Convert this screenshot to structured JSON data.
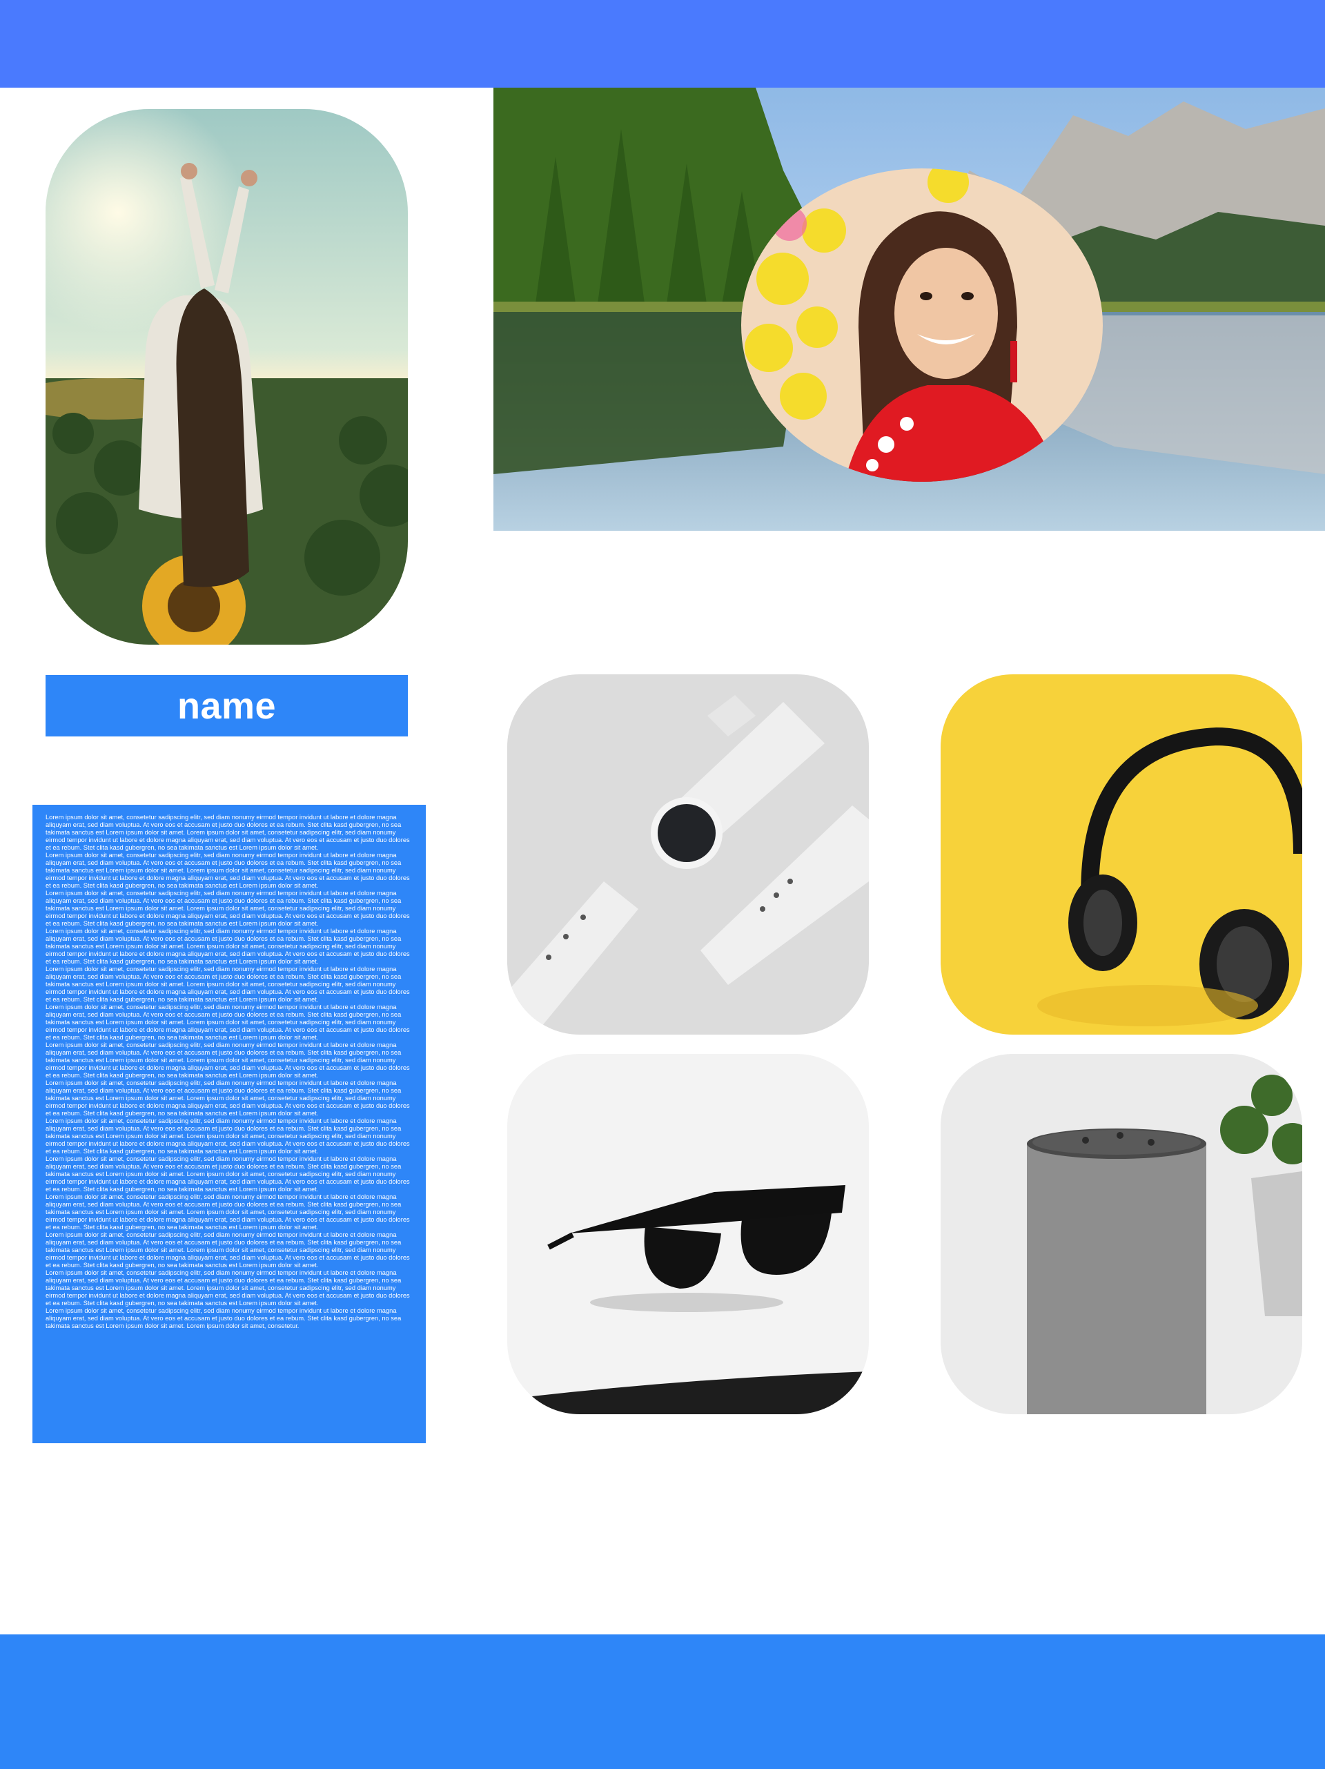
{
  "colors": {
    "header": "#4a7afe",
    "footer": "#2e86f8",
    "accent": "#2e86f8",
    "text_on_accent": "#ffffff"
  },
  "profile": {
    "photo_icon": "woman-in-sunflower-field-image",
    "cover_icon": "mountain-lake-landscape-image",
    "avatar_icon": "smiling-woman-portrait-image",
    "name": "name",
    "bio_paragraph": "Lorem ipsum dolor sit amet, consetetur sadipscing elitr, sed diam nonumy eirmod tempor invidunt ut labore et dolore magna aliquyam erat, sed diam voluptua. At vero eos et accusam et justo duo dolores et ea rebum. Stet clita kasd gubergren, no sea takimata sanctus est Lorem ipsum dolor sit amet. Lorem ipsum dolor sit amet, consetetur sadipscing elitr, sed diam nonumy eirmod tempor invidunt ut labore et dolore magna aliquyam erat, sed diam voluptua. At vero eos et accusam et justo duo dolores et ea rebum. Stet clita kasd gubergren, no sea takimata sanctus est Lorem ipsum dolor sit amet.",
    "bio_repeat": 13,
    "bio_last": "Lorem ipsum dolor sit amet, consetetur sadipscing elitr, sed diam nonumy eirmod tempor invidunt ut labore et dolore magna aliquyam erat, sed diam voluptua. At vero eos et accusam et justo duo dolores et ea rebum. Stet clita kasd gubergren, no sea takimata sanctus est Lorem ipsum dolor sit amet. Lorem ipsum dolor sit amet, consetetur."
  },
  "products": [
    {
      "icon": "smartwatch-image"
    },
    {
      "icon": "headphones-image"
    },
    {
      "icon": "sunglasses-image"
    },
    {
      "icon": "smart-speaker-image"
    }
  ]
}
